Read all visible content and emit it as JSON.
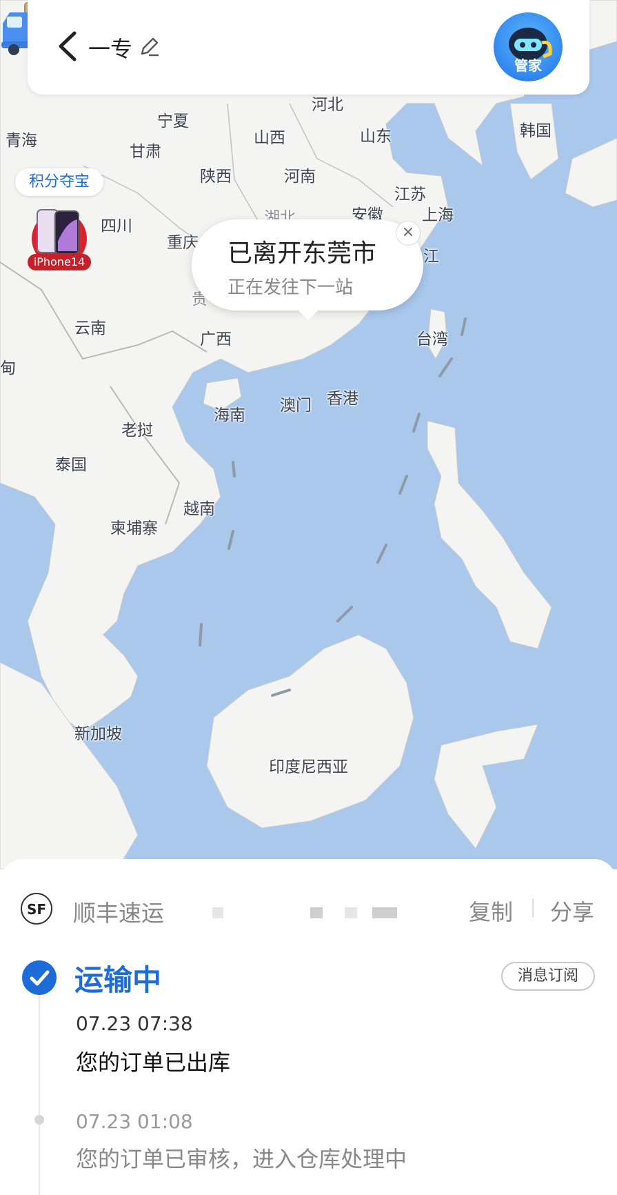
{
  "header": {
    "title": "一专",
    "assistant_label": "管家"
  },
  "map": {
    "places": {
      "hebei": "河北",
      "ningxia": "宁夏",
      "qinghai": "青海",
      "shanxi": "山西",
      "shandong": "山东",
      "gansu": "甘肃",
      "hanguo": "韩国",
      "shaanxi": "陕西",
      "henan": "河南",
      "jiangsu": "江苏",
      "hubei": "湖北",
      "anhui": "安徽",
      "shanghai": "上海",
      "sichuan": "四川",
      "chongqing": "重庆",
      "zhejiang": "江",
      "guizhou": "贵",
      "yunnan": "云南",
      "guangxi": "广西",
      "taiwan": "台湾",
      "myanmar": "甸",
      "hainan": "海南",
      "macau": "澳门",
      "hongkong": "香港",
      "laos": "老挝",
      "thailand": "泰国",
      "vietnam": "越南",
      "cambodia": "柬埔寨",
      "singapore": "新加坡",
      "indonesia": "印度尼西亚"
    },
    "promo": {
      "label": "积分夺宝",
      "product": "iPhone14"
    },
    "popup": {
      "title": "已离开东莞市",
      "subtitle": "正在发往下一站",
      "close": "×"
    }
  },
  "sheet": {
    "carrier": "顺丰速运",
    "copy_label": "复制",
    "share_label": "分享",
    "status": "运输中",
    "subscribe_label": "消息订阅",
    "events": [
      {
        "time": "07.23 07:38",
        "desc": "您的订单已出库"
      },
      {
        "time": "07.23 01:08",
        "desc": "您的订单已审核，进入仓库处理中"
      }
    ]
  },
  "colors": {
    "accent": "#1e6cd8",
    "sea": "#a9c8ec",
    "land": "#f4f4f2"
  }
}
